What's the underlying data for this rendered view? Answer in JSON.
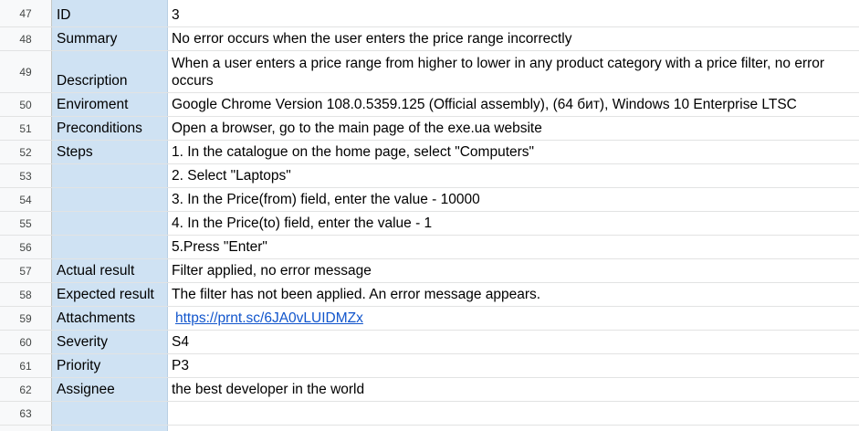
{
  "rows": [
    {
      "num": "47",
      "field": "ID",
      "value": "3"
    },
    {
      "num": "48",
      "field": "Summary",
      "value": "No error occurs when the user enters the price range incorrectly"
    },
    {
      "num": "49",
      "field": "Description",
      "value": "When a user enters a price range from higher to lower in any product category with a price filter, no error occurs"
    },
    {
      "num": "50",
      "field": "Enviroment",
      "value": "Google Chrome Version 108.0.5359.125 (Official assembly), (64 бит), Windows 10 Enterprise LTSC"
    },
    {
      "num": "51",
      "field": "Preconditions",
      "value": "Open a browser, go to the main page of the exe.ua website"
    },
    {
      "num": "52",
      "field": "Steps",
      "value": "1. In the catalogue on the home page, select \"Computers\""
    },
    {
      "num": "53",
      "field": "",
      "value": "2. Select \"Laptops\""
    },
    {
      "num": "54",
      "field": "",
      "value": "3. In the Price(from) field, enter the value - 10000"
    },
    {
      "num": "55",
      "field": "",
      "value": "4. In the Price(to) field, enter the value - 1"
    },
    {
      "num": "56",
      "field": "",
      "value": "5.Press \"Enter\""
    },
    {
      "num": "57",
      "field": "Actual result",
      "value": "Filter applied, no error message"
    },
    {
      "num": "58",
      "field": "Expected result",
      "value": "The filter has not been applied. An error message appears."
    },
    {
      "num": "59",
      "field": "Attachments",
      "value": "https://prnt.sc/6JA0vLUIDMZx"
    },
    {
      "num": "60",
      "field": "Severity",
      "value": "S4"
    },
    {
      "num": "61",
      "field": "Priority",
      "value": "P3"
    },
    {
      "num": "62",
      "field": "Assignee",
      "value": "the best developer in the world"
    },
    {
      "num": "63",
      "field": "",
      "value": ""
    }
  ],
  "colors": {
    "header_col": "#cfe2f3",
    "row_header_bg": "#f8f9fa",
    "gridline": "#e2e3e3",
    "link": "#1155cc"
  }
}
